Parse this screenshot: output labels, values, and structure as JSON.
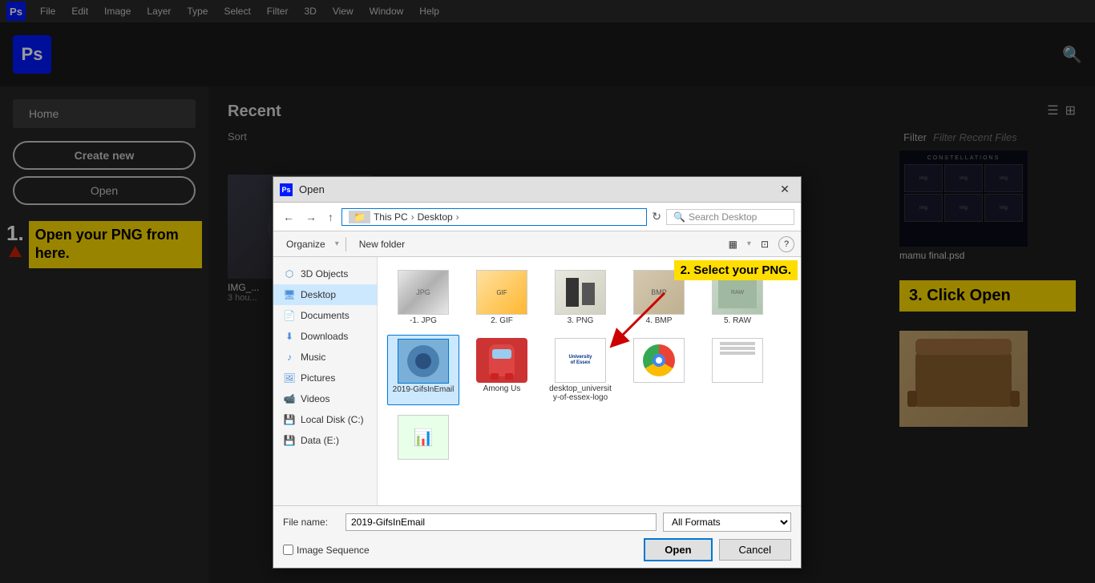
{
  "menubar": {
    "items": [
      "File",
      "Edit",
      "Image",
      "Layer",
      "Type",
      "Select",
      "Filter",
      "3D",
      "View",
      "Window",
      "Help"
    ]
  },
  "topbar": {
    "ps_label": "Ps"
  },
  "sidebar": {
    "home_label": "Home",
    "create_new_label": "Create new",
    "open_label": "Open",
    "instruction1_num": "1.",
    "instruction1_text": "Open your PNG from here."
  },
  "content": {
    "recent_title": "Recent",
    "sort_label": "Sort",
    "filter_label": "Filter",
    "filter_placeholder": "Filter Recent Files",
    "view_list": "☰",
    "view_grid": "⊞",
    "items": [
      {
        "name": "IMG_...",
        "time": "3 hou..."
      },
      {
        "name": "mamu final.psd",
        "time": ""
      },
      {
        "name": "",
        "time": ""
      }
    ]
  },
  "dialog": {
    "title": "Open",
    "ps_label": "Ps",
    "address": {
      "back": "←",
      "forward": "→",
      "up": "↑",
      "path": [
        "This PC",
        "Desktop"
      ],
      "refresh": "↻",
      "search_placeholder": "Search Desktop"
    },
    "toolbar": {
      "organize": "Organize",
      "new_folder": "New folder",
      "view_btn1": "▦",
      "view_btn2": "⊡",
      "help": "?"
    },
    "nav_items": [
      {
        "label": "3D Objects",
        "icon": "3d"
      },
      {
        "label": "Desktop",
        "icon": "desktop",
        "active": true
      },
      {
        "label": "Documents",
        "icon": "documents"
      },
      {
        "label": "Downloads",
        "icon": "downloads"
      },
      {
        "label": "Music",
        "icon": "music"
      },
      {
        "label": "Pictures",
        "icon": "pictures"
      },
      {
        "label": "Videos",
        "icon": "videos"
      },
      {
        "label": "Local Disk (C:)",
        "icon": "disk"
      },
      {
        "label": "Data (E:)",
        "icon": "disk2"
      }
    ],
    "files": [
      {
        "name": "-1. JPG",
        "type": "jpg",
        "row": 0
      },
      {
        "name": "2. GIF",
        "type": "gif",
        "row": 0
      },
      {
        "name": "3. PNG",
        "type": "png",
        "row": 0
      },
      {
        "name": "4. BMP",
        "type": "bmp",
        "row": 0
      },
      {
        "name": "5. RAW",
        "type": "raw",
        "row": 1
      },
      {
        "name": "2019-GifsInEmail",
        "type": "gifs",
        "row": 1,
        "selected": true
      },
      {
        "name": "Among Us",
        "type": "among",
        "row": 1
      },
      {
        "name": "desktop_university-of-essex-logo",
        "type": "essex",
        "row": 1
      },
      {
        "name": "",
        "type": "chrome",
        "row": 2
      },
      {
        "name": "",
        "type": "doc",
        "row": 2
      },
      {
        "name": "",
        "type": "xls",
        "row": 2
      }
    ],
    "filename_label": "File name:",
    "filename_value": "2019-GifsInEmail",
    "filetype_label": "All Formats",
    "image_sequence_label": "Image Sequence",
    "open_btn": "Open",
    "cancel_btn": "Cancel",
    "instruction2_text": "2. Select your PNG.",
    "instruction3_text": "3.  Click Open"
  }
}
